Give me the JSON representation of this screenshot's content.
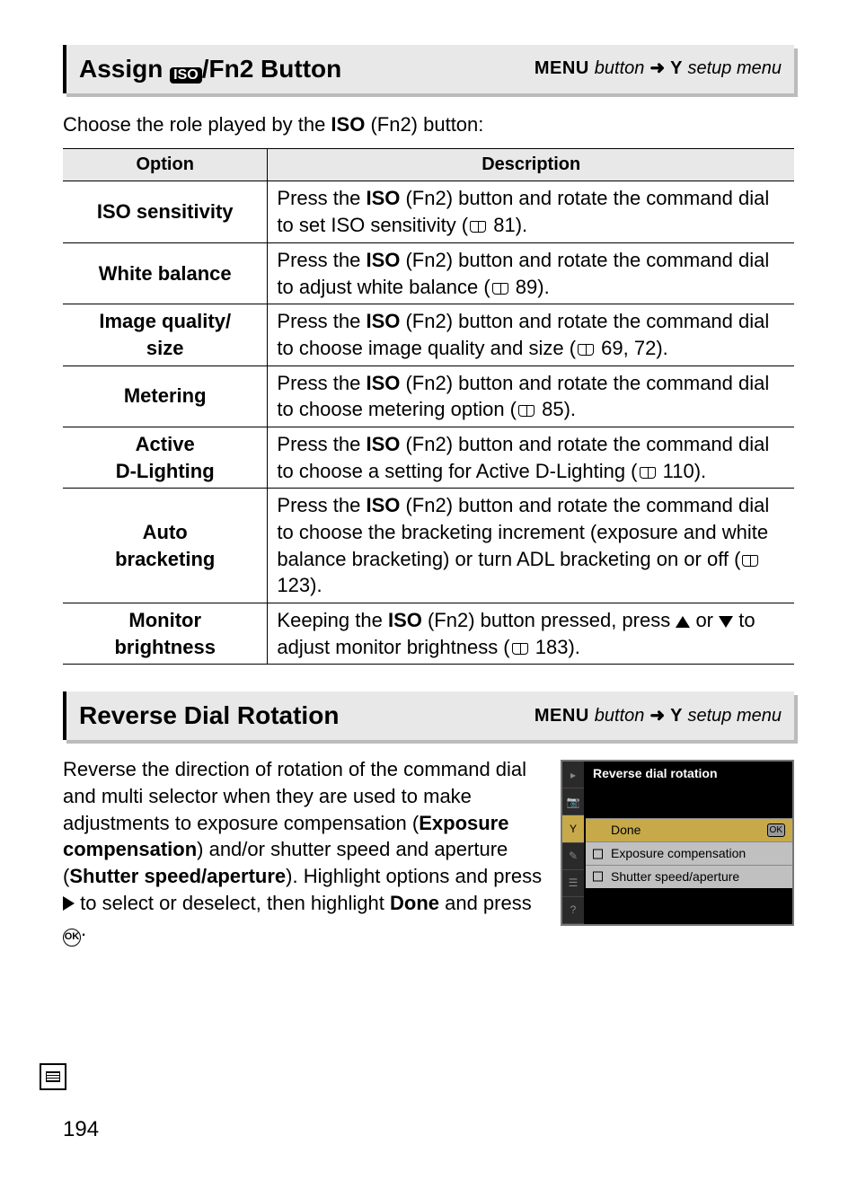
{
  "section1": {
    "title_prefix": "Assign ",
    "title_suffix": "/Fn2 Button",
    "iso_glyph": "ISO",
    "crumb_menu": "MENU",
    "crumb_button": " button",
    "crumb_setup": " setup menu"
  },
  "intro": {
    "pre": "Choose the role played by the ",
    "bold": "ISO",
    "post": " (Fn2) button:"
  },
  "table": {
    "head_option": "Option",
    "head_desc": "Description",
    "rows": [
      {
        "option": "ISO sensitivity",
        "d_pre": "Press the ",
        "d_bold": "ISO",
        "d_mid": " (Fn2) button and rotate the command dial to set ISO sensitivity (",
        "d_ref": " 81).",
        "ref": "81"
      },
      {
        "option": "White balance",
        "d_pre": "Press the ",
        "d_bold": "ISO",
        "d_mid": " (Fn2) button and rotate the command dial to adjust white balance (",
        "d_ref": " 89).",
        "ref": "89"
      },
      {
        "option": "Image quality/\nsize",
        "d_pre": "Press the ",
        "d_bold": "ISO",
        "d_mid": " (Fn2) button and rotate the command dial to choose image quality and size (",
        "d_ref": " 69, 72).",
        "ref": "69, 72"
      },
      {
        "option": "Metering",
        "d_pre": "Press the ",
        "d_bold": "ISO",
        "d_mid": " (Fn2) button and rotate the command dial to choose metering option (",
        "d_ref": " 85).",
        "ref": "85"
      },
      {
        "option": "Active\nD-Lighting",
        "d_pre": "Press the ",
        "d_bold": "ISO",
        "d_mid": " (Fn2) button and rotate the command dial to choose a setting for Active D-Lighting (",
        "d_ref": " 110).",
        "ref": "110"
      },
      {
        "option": "Auto\nbracketing",
        "d_pre": "Press the ",
        "d_bold": "ISO",
        "d_mid": " (Fn2) button and rotate the command dial to choose the bracketing increment (exposure and white balance bracketing) or turn ADL bracketing on or off (",
        "d_ref": " 123).",
        "ref": "123"
      },
      {
        "option": "Monitor\nbrightness",
        "mb_pre": "Keeping the ",
        "mb_bold": "ISO",
        "mb_mid1": " (Fn2) button pressed, press ",
        "mb_mid2": " or ",
        "mb_mid3": " to adjust monitor brightness (",
        "mb_ref": " 183).",
        "ref": "183"
      }
    ]
  },
  "section2": {
    "title": "Reverse Dial Rotation",
    "crumb_menu": "MENU",
    "crumb_button": " button",
    "crumb_setup": " setup menu"
  },
  "reverse_para": {
    "t1": "Reverse the direction of rotation of the command dial and multi selector when they are used to make adjustments to exposure compensation (",
    "b1": "Exposure compensation",
    "t2": ") and/or shutter speed and aperture (",
    "b2": "Shutter speed/aperture",
    "t3": ").  Highlight options and press ",
    "t4": " to select or deselect, then highlight ",
    "b3": "Done",
    "t5": " and press ",
    "t6": "."
  },
  "screen": {
    "title": "Reverse dial rotation",
    "row_done": "Done",
    "row_done_ok": "OK",
    "row_exp": "Exposure compensation",
    "row_shutter": "Shutter speed/aperture",
    "side": [
      "▸",
      "📷",
      "Y",
      "✎",
      "☰",
      "?"
    ]
  },
  "page_number": "194"
}
